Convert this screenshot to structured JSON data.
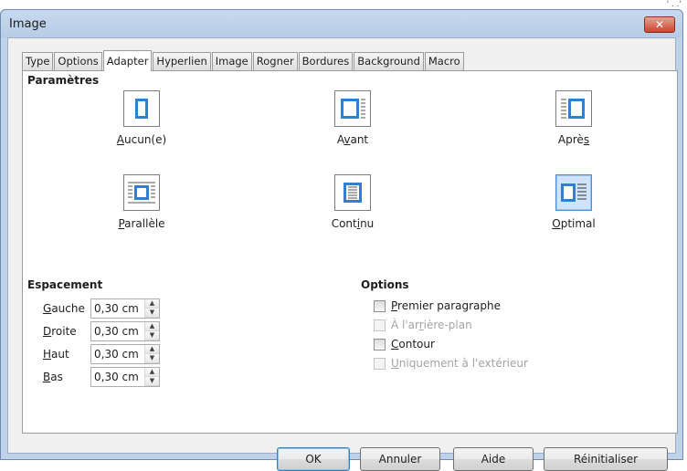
{
  "window": {
    "title": "Image",
    "close_glyph": "✕",
    "corner_text": "' . .'"
  },
  "tabs": [
    {
      "label": "Type"
    },
    {
      "label": "Options"
    },
    {
      "label": "Adapter",
      "active": true
    },
    {
      "label": "Hyperlien"
    },
    {
      "label": "Image"
    },
    {
      "label": "Rogner"
    },
    {
      "label": "Bordures"
    },
    {
      "label": "Background"
    },
    {
      "label": "Macro"
    }
  ],
  "parametres": {
    "heading": "Paramètres",
    "options": [
      {
        "label_pre": "",
        "label_u": "A",
        "label_post": "ucun(e)",
        "icon": "wrap-none-icon",
        "selected": false
      },
      {
        "label_pre": "A",
        "label_u": "v",
        "label_post": "ant",
        "icon": "wrap-before-icon",
        "selected": false
      },
      {
        "label_pre": "Aprè",
        "label_u": "s",
        "label_post": "",
        "icon": "wrap-after-icon",
        "selected": false
      },
      {
        "label_pre": "",
        "label_u": "P",
        "label_post": "arallèle",
        "icon": "wrap-parallel-icon",
        "selected": false
      },
      {
        "label_pre": "Cont",
        "label_u": "i",
        "label_post": "nu",
        "icon": "wrap-through-icon",
        "selected": false
      },
      {
        "label_pre": "",
        "label_u": "O",
        "label_post": "ptimal",
        "icon": "wrap-optimal-icon",
        "selected": true
      }
    ]
  },
  "espacement": {
    "heading": "Espacement",
    "fields": [
      {
        "label_u": "G",
        "label_post": "auche",
        "value": "0,30 cm"
      },
      {
        "label_u": "D",
        "label_post": "roite",
        "value": "0,30 cm"
      },
      {
        "label_u": "H",
        "label_post": "aut",
        "value": "0,30 cm"
      },
      {
        "label_u": "B",
        "label_post": "as",
        "value": "0,30 cm"
      }
    ],
    "spin_up": "▲",
    "spin_down": "▼"
  },
  "options": {
    "heading": "Options",
    "items": [
      {
        "label_pre": "",
        "label_u": "P",
        "label_post": "remier paragraphe",
        "checked": false,
        "enabled": true
      },
      {
        "label_pre": "À l'ar",
        "label_u": "r",
        "label_post": "ière-plan",
        "checked": false,
        "enabled": false
      },
      {
        "label_pre": "",
        "label_u": "C",
        "label_post": "ontour",
        "checked": false,
        "enabled": true
      },
      {
        "label_pre": "",
        "label_u": "U",
        "label_post": "niquement à l'extérieur",
        "checked": false,
        "enabled": false
      }
    ]
  },
  "buttons": {
    "ok": "OK",
    "cancel": "Annuler",
    "help": "Aide",
    "reset": "Réinitialiser"
  }
}
